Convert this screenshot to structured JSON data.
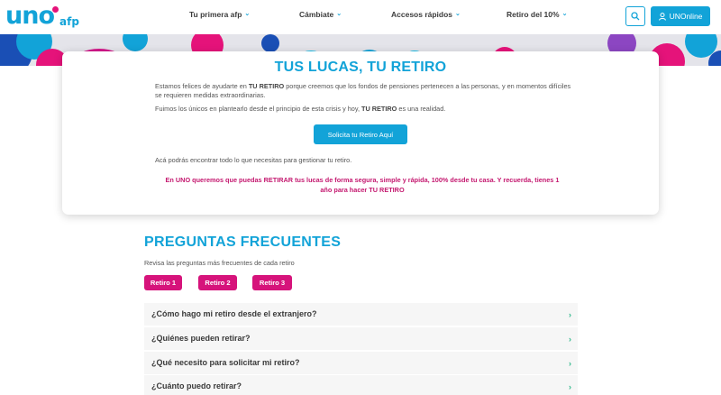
{
  "brand": {
    "logo_main": "uno",
    "logo_sub": "afp",
    "colors": {
      "primary": "#12a3d8",
      "accent": "#d6137b",
      "arrow": "#2fb88a"
    }
  },
  "nav": {
    "items": [
      {
        "label": "Tu primera afp"
      },
      {
        "label": "Cámbiate"
      },
      {
        "label": "Accesos rápidos"
      },
      {
        "label": "Retiro del 10%"
      }
    ],
    "search_icon": "search-icon",
    "login_label": "UNOnline",
    "login_icon": "user-icon"
  },
  "hero": {
    "title": "TUS LUCAS, TU RETIRO",
    "p1_a": "Estamos felices de ayudarte en ",
    "p1_b": "TU RETIRO",
    "p1_c": " porque creemos que los fondos de pensiones pertenecen a las personas, y en momentos difíciles se requieren medidas extraordinarias.",
    "p2_a": "Fuimos los únicos en plantearlo desde el principio de esta crisis y hoy, ",
    "p2_b": "TU RETIRO",
    "p2_c": " es una realidad.",
    "cta_label": "Solicita tu Retiro Aquí",
    "p3": "Acá podrás encontrar todo lo que necesitas para gestionar tu retiro.",
    "highlight": "En UNO queremos que puedas RETIRAR tus lucas de forma segura, simple y rápida, 100% desde tu casa. Y recuerda, tienes 1 año para hacer TU RETIRO"
  },
  "faq": {
    "title": "PREGUNTAS FRECUENTES",
    "subtitle": "Revisa las preguntas más frecuentes de cada retiro",
    "tabs": [
      {
        "label": "Retiro 1"
      },
      {
        "label": "Retiro 2"
      },
      {
        "label": "Retiro 3"
      }
    ],
    "questions": [
      {
        "q": "¿Cómo hago mi retiro desde el extranjero?",
        "arrow": "›"
      },
      {
        "q": "¿Quiénes pueden retirar?",
        "arrow": "›"
      },
      {
        "q": "¿Qué necesito para solicitar mi retiro?",
        "arrow": "›"
      },
      {
        "q": "¿Cuánto puedo retirar?",
        "arrow": "›"
      }
    ]
  }
}
